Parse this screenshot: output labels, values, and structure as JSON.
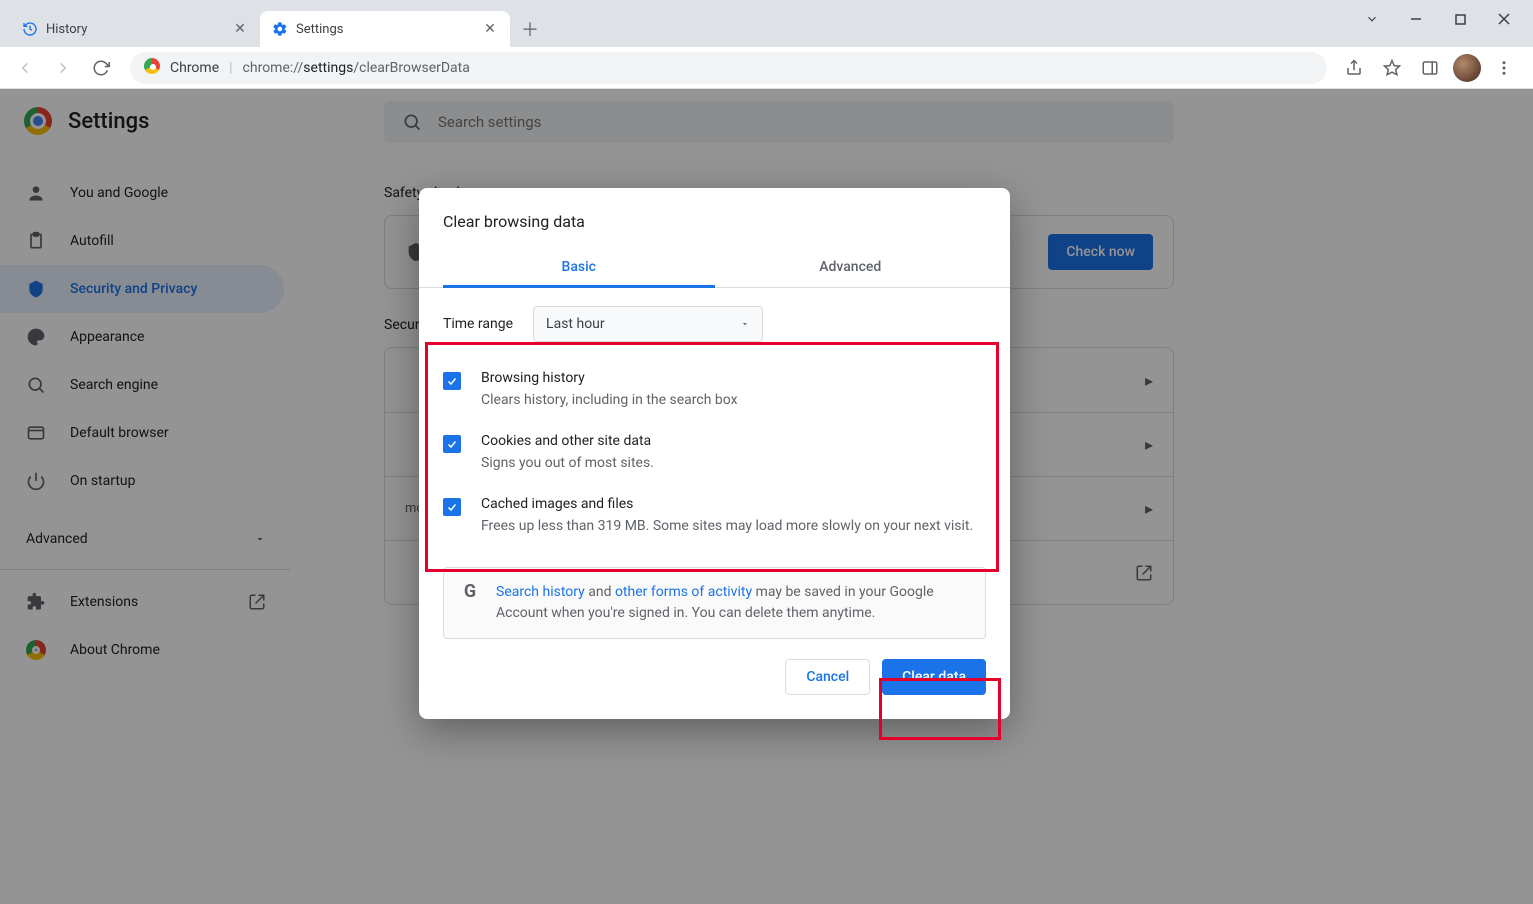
{
  "tabs": [
    {
      "title": "History"
    },
    {
      "title": "Settings"
    }
  ],
  "omnibox": {
    "scheme_label": "Chrome",
    "host": "chrome://",
    "path_bold": "settings",
    "path_rest": "/clearBrowserData"
  },
  "settings": {
    "page_title": "Settings",
    "search_placeholder": "Search settings",
    "sidebar": {
      "items": [
        "You and Google",
        "Autofill",
        "Security and Privacy",
        "Appearance",
        "Search engine",
        "Default browser",
        "On startup"
      ],
      "advanced": "Advanced",
      "extensions": "Extensions",
      "about": "About Chrome"
    },
    "safety": {
      "section": "Safety check",
      "button": "Check now"
    },
    "security_section": "Security and Privacy",
    "rows_more": "more)"
  },
  "dialog": {
    "title": "Clear browsing data",
    "tab_basic": "Basic",
    "tab_advanced": "Advanced",
    "time_range_label": "Time range",
    "time_range_value": "Last hour",
    "items": [
      {
        "title": "Browsing history",
        "sub": "Clears history, including in the search box"
      },
      {
        "title": "Cookies and other site data",
        "sub": "Signs you out of most sites."
      },
      {
        "title": "Cached images and files",
        "sub": "Frees up less than 319 MB. Some sites may load more slowly on your next visit."
      }
    ],
    "info": {
      "link1": "Search history",
      "mid1": " and ",
      "link2": "other forms of activity",
      "rest": " may be saved in your Google Account when you're signed in. You can delete them anytime."
    },
    "cancel": "Cancel",
    "clear": "Clear data"
  }
}
